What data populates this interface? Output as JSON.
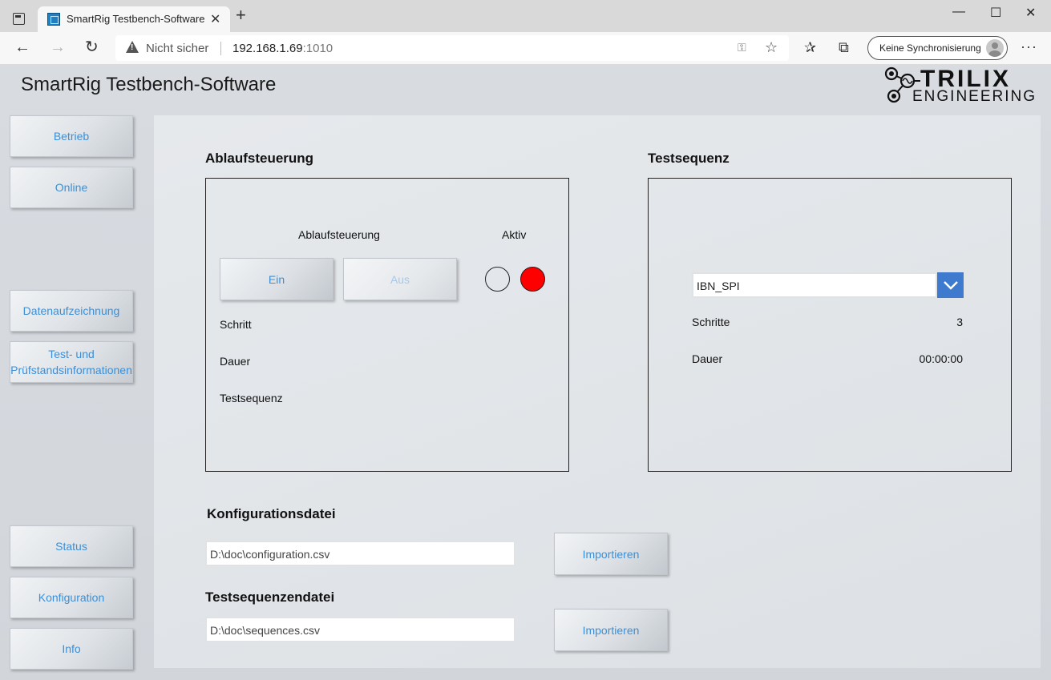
{
  "browser": {
    "tab_title": "SmartRig Testbench-Software",
    "new_tab": "+",
    "tab_close": "✕",
    "not_secure": "Nicht sicher",
    "url_host": "192.168.1.69",
    "url_port": ":1010",
    "sync_label": "Keine Synchronisierung",
    "more": "···",
    "win_min": "—",
    "win_max": "☐",
    "win_close": "✕",
    "back": "←",
    "forward": "→",
    "reload": "↻"
  },
  "app": {
    "title": "SmartRig Testbench-Software",
    "logo_line1": "TRILIX",
    "logo_line2": "ENGINEERING"
  },
  "sidebar": {
    "items": [
      {
        "label": "Betrieb"
      },
      {
        "label": "Online"
      },
      {
        "label": "Datenaufzeichnung"
      },
      {
        "label": "Test- und Prüfstandsinformationen"
      },
      {
        "label": "Status"
      },
      {
        "label": "Konfiguration"
      },
      {
        "label": "Info"
      }
    ]
  },
  "ablauf": {
    "section_title": "Ablaufsteuerung",
    "control_label": "Ablaufsteuerung",
    "active_label": "Aktiv",
    "btn_on": "Ein",
    "btn_off": "Aus",
    "schritt_label": "Schritt",
    "dauer_label": "Dauer",
    "testsequenz_label": "Testsequenz",
    "status_colors": {
      "off": "transparent",
      "on": "#ff0000"
    }
  },
  "testsequenz": {
    "section_title": "Testsequenz",
    "selected": "IBN_SPI",
    "schritte_label": "Schritte",
    "schritte_value": "3",
    "dauer_label": "Dauer",
    "dauer_value": "00:00:00"
  },
  "config": {
    "title": "Konfigurationsdatei",
    "path": "D:\\doc\\configuration.csv",
    "import_label": "Importieren"
  },
  "sequence_file": {
    "title": "Testsequenzendatei",
    "path": "D:\\doc\\sequences.csv",
    "import_label": "Importieren"
  },
  "colors": {
    "accent": "#3c8fd6",
    "dropdown": "#3e7bcf",
    "led_active": "#ff0000"
  }
}
